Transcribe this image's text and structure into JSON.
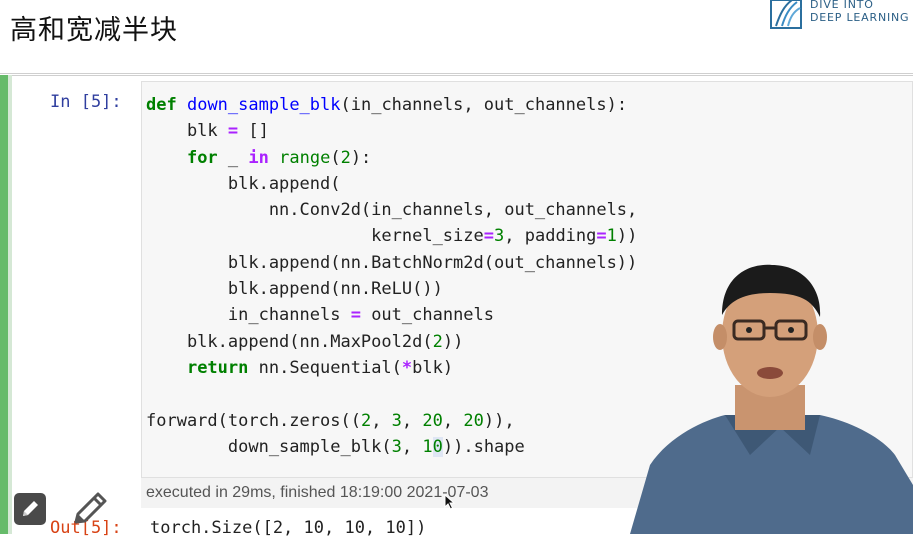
{
  "header": {
    "title": "高和宽减半块",
    "logo_line1": "DIVE INTO",
    "logo_line2": "DEEP LEARNING"
  },
  "cell": {
    "in_prompt": "In [5]:",
    "code_lines": [
      "def down_sample_blk(in_channels, out_channels):",
      "    blk = []",
      "    for _ in range(2):",
      "        blk.append(",
      "            nn.Conv2d(in_channels, out_channels,",
      "                      kernel_size=3, padding=1))",
      "        blk.append(nn.BatchNorm2d(out_channels))",
      "        blk.append(nn.ReLU())",
      "        in_channels = out_channels",
      "    blk.append(nn.MaxPool2d(2))",
      "    return nn.Sequential(*blk)",
      "",
      "forward(torch.zeros((2, 3, 20, 20)),",
      "        down_sample_blk(3, 10)).shape"
    ],
    "execution_info": "executed in 29ms, finished 18:19:00 2021-07-03",
    "out_prompt": "Out[5]:",
    "output": "torch.Size([2, 10, 10, 10])"
  },
  "colors": {
    "cell_bar": "#66bb6a",
    "in_prompt": "#303f9f",
    "out_prompt": "#d84315",
    "keyword": "#008000",
    "function_name": "#0000ff",
    "operator": "#aa22ff"
  },
  "icons": [
    "logo-mark-icon",
    "edit-icon",
    "pencil-icon",
    "mouse-cursor-icon"
  ]
}
